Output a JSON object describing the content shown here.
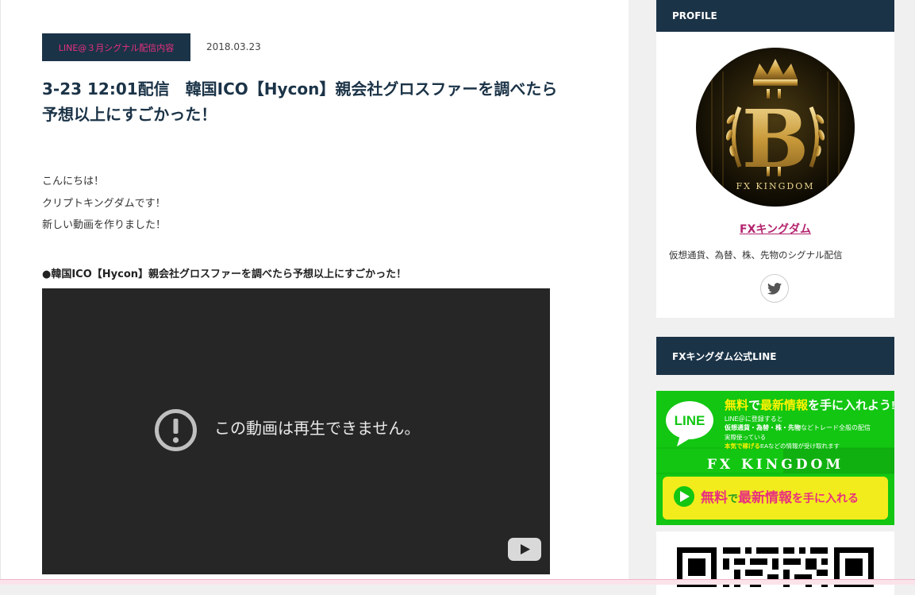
{
  "post": {
    "category": "LINE@３月シグナル配信内容",
    "date": "2018.03.23",
    "title_line1": "3-23 12:01配信　韓国ICO【Hycon】親会社グロスファーを調べたら",
    "title_line2": "予想以上にすごかった！",
    "intro": [
      "こんにちは！",
      "クリプトキングダムです！",
      "新しい動画を作りました！"
    ],
    "video_heading": "●韓国ICO【Hycon】親会社グロスファーを調べたら予想以上にすごかった！",
    "video": {
      "error_message": "この動画は再生できません。",
      "error_icon": "exclamation-circle-icon",
      "logo_icon": "youtube-play-icon"
    }
  },
  "sidebar": {
    "profile": {
      "header": "PROFILE",
      "avatar_text": "FX KINGDOM",
      "avatar_letter": "B",
      "name": "FXキングダム",
      "description": "仮想通貨、為替、株、先物のシグナル配信",
      "social_icon": "twitter-icon"
    },
    "line_widget": {
      "header": "FXキングダム公式LINE",
      "banner": {
        "logo": "LINE",
        "headline_parts": [
          "無料",
          "で",
          "最新情報",
          "を手に入れよう!"
        ],
        "sub1": "LINE＠に登録すると",
        "sub2_parts": [
          "仮想通貨・為替・株・先物",
          "などトレード全般の配信"
        ],
        "sub3": "実際使っている",
        "sub4_parts": [
          "本気で稼げる",
          "EAなどの情報が受け取れます"
        ],
        "brand": "FX KINGDOM",
        "cta_parts": [
          "無料",
          "で",
          "最新情報",
          "を手に入れる"
        ]
      }
    }
  },
  "colors": {
    "navy": "#1b3347",
    "accent_pink": "#e8307f",
    "profile_link": "#b3246e",
    "line_green": "#11c611",
    "cta_yellow": "#f2ec1c"
  }
}
